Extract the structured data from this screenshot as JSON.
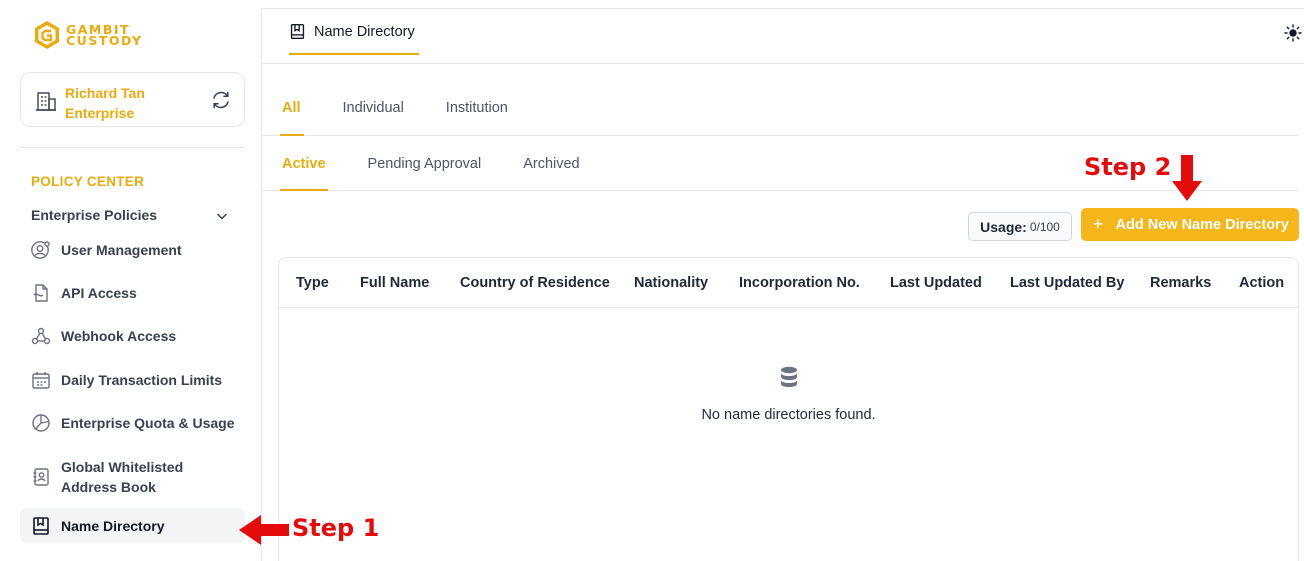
{
  "brand": {
    "line1": "GAMBIT",
    "line2": "CUSTODY",
    "color": "#e9ac0e"
  },
  "account": {
    "name": "Richard Tan Enterprise"
  },
  "sidebar": {
    "section_title": "POLICY CENTER",
    "group_title": "Enterprise Policies",
    "items": [
      {
        "label": "User Management",
        "icon": "user-gear-icon"
      },
      {
        "label": "API Access",
        "icon": "api-file-icon"
      },
      {
        "label": "Webhook Access",
        "icon": "webhook-icon"
      },
      {
        "label": "Daily Transaction Limits",
        "icon": "calendar-icon"
      },
      {
        "label": "Enterprise Quota & Usage",
        "icon": "pie-chart-icon"
      },
      {
        "label": "Global Whitelisted Address Book",
        "icon": "contacts-book-icon"
      },
      {
        "label": "Name Directory",
        "icon": "book-icon",
        "active": true
      }
    ]
  },
  "header": {
    "tab_label": "Name Directory"
  },
  "tabs_primary": [
    "All",
    "Individual",
    "Institution"
  ],
  "tabs_secondary": [
    "Active",
    "Pending Approval",
    "Archived"
  ],
  "usage": {
    "label": "Usage:",
    "value": "0/100"
  },
  "add_button": {
    "icon": "+",
    "label": "Add New Name Directory"
  },
  "table": {
    "columns": [
      "Type",
      "Full Name",
      "Country of Residence",
      "Nationality",
      "Incorporation No.",
      "Last Updated",
      "Last Updated By",
      "Remarks",
      "Action"
    ],
    "empty_message": "No name directories found."
  },
  "annotations": {
    "step1": "Step 1",
    "step2": "Step 2",
    "color": "#e50b0b"
  },
  "accent": "#f5b61a"
}
